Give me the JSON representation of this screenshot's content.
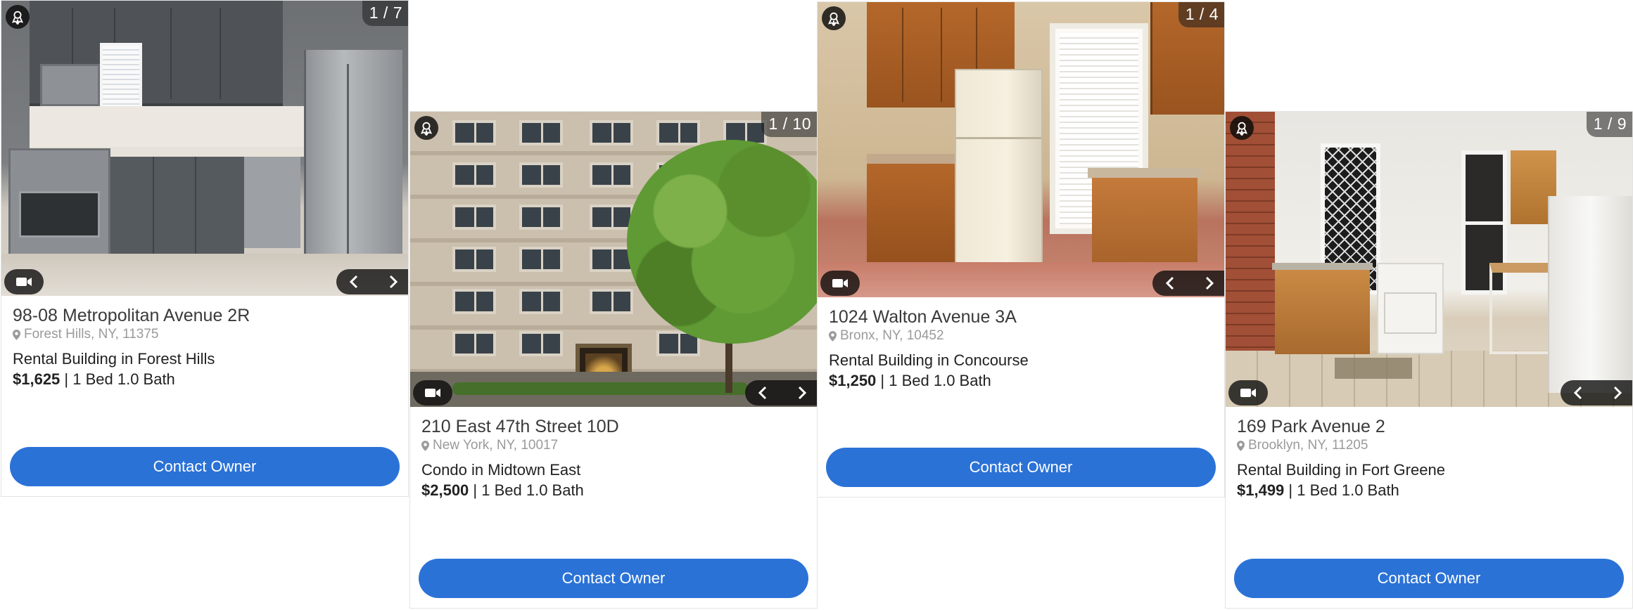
{
  "accent_color": "#2b72d7",
  "listings": [
    {
      "photo_counter": "1 / 7",
      "title": "98-08 Metropolitan Avenue 2R",
      "location": "Forest Hills, NY, 11375",
      "building": "Rental Building in Forest Hills",
      "price": "$1,625",
      "details": " | 1 Bed 1.0 Bath",
      "button_label": "Contact Owner"
    },
    {
      "photo_counter": "1 / 10",
      "title": "210 East 47th Street 10D",
      "location": "New York, NY, 10017",
      "building": "Condo in Midtown East",
      "price": "$2,500",
      "details": " | 1 Bed 1.0 Bath",
      "button_label": "Contact Owner"
    },
    {
      "photo_counter": "1 / 4",
      "title": "1024 Walton Avenue 3A",
      "location": "Bronx, NY, 10452",
      "building": "Rental Building in Concourse",
      "price": "$1,250",
      "details": " | 1 Bed 1.0 Bath",
      "button_label": "Contact Owner"
    },
    {
      "photo_counter": "1 / 9",
      "title": "169 Park Avenue 2",
      "location": "Brooklyn, NY, 11205",
      "building": "Rental Building in Fort Greene",
      "price": "$1,499",
      "details": " | 1 Bed 1.0 Bath",
      "button_label": "Contact Owner"
    }
  ],
  "icons": {
    "badge": "award-ribbon-icon",
    "video": "video-camera-icon",
    "prev": "chevron-left-icon",
    "next": "chevron-right-icon",
    "location": "map-pin-icon"
  }
}
